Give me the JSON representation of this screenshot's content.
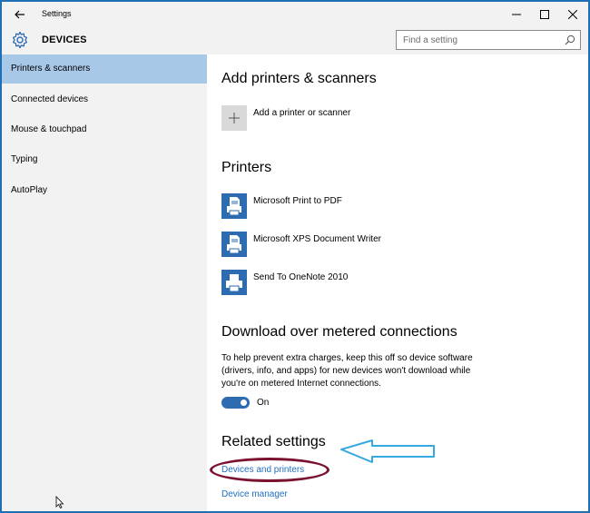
{
  "window": {
    "title": "Settings",
    "controls": [
      "minimize-icon",
      "maximize-icon",
      "close-icon"
    ]
  },
  "header": {
    "section": "DEVICES",
    "search_placeholder": "Find a setting"
  },
  "sidebar": {
    "items": [
      {
        "label": "Printers & scanners",
        "active": true
      },
      {
        "label": "Connected devices",
        "active": false
      },
      {
        "label": "Mouse & touchpad",
        "active": false
      },
      {
        "label": "Typing",
        "active": false
      },
      {
        "label": "AutoPlay",
        "active": false
      }
    ]
  },
  "content": {
    "add_section": {
      "title": "Add printers & scanners",
      "add_label": "Add a printer or scanner"
    },
    "printers_section": {
      "title": "Printers",
      "items": [
        {
          "label": "Microsoft Print to PDF",
          "icon": "pdf-printer-icon"
        },
        {
          "label": "Microsoft XPS Document Writer",
          "icon": "xps-printer-icon"
        },
        {
          "label": "Send To OneNote 2010",
          "icon": "printer-icon"
        }
      ]
    },
    "metered_section": {
      "title": "Download over metered connections",
      "description": "To help prevent extra charges, keep this off so device software (drivers, info, and apps) for new devices won't download while you're on metered Internet connections.",
      "toggle_state": "On"
    },
    "related_section": {
      "title": "Related settings",
      "links": [
        "Devices and printers",
        "Device manager"
      ]
    }
  },
  "colors": {
    "accent": "#2d6cb0",
    "sidebar_bg": "#f2f2f2",
    "active_bg": "#a8c8e8",
    "link": "#1f6fc0",
    "annotation_ellipse": "#7a1230",
    "annotation_arrow": "#36a9e1"
  }
}
